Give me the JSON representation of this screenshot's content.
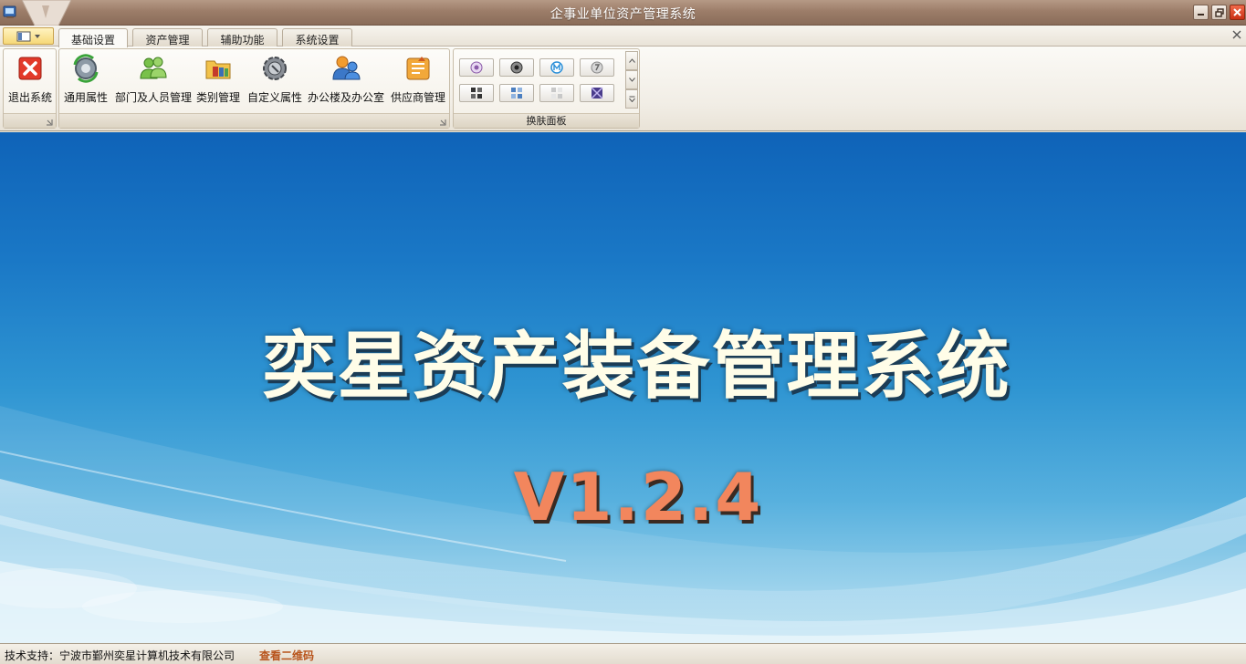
{
  "window": {
    "title": "企事业单位资产管理系统"
  },
  "ribbon": {
    "tabs": [
      {
        "label": "基础设置",
        "active": true
      },
      {
        "label": "资产管理",
        "active": false
      },
      {
        "label": "辅助功能",
        "active": false
      },
      {
        "label": "系统设置",
        "active": false
      }
    ],
    "exit_group": {
      "buttons": [
        {
          "label": "退出系统",
          "icon": "exit-icon"
        }
      ]
    },
    "basic_group": {
      "buttons": [
        {
          "label": "通用属性",
          "icon": "gear-refresh-icon"
        },
        {
          "label": "部门及人员管理",
          "icon": "users-icon"
        },
        {
          "label": "类别管理",
          "icon": "category-folder-icon"
        },
        {
          "label": "自定义属性",
          "icon": "custom-gear-icon"
        },
        {
          "label": "办公楼及办公室",
          "icon": "office-user-icon"
        },
        {
          "label": "供应商管理",
          "icon": "supplier-icon"
        }
      ]
    },
    "skin_group": {
      "label": "换肤面板"
    }
  },
  "main": {
    "title": "奕星资产装备管理系统",
    "version": "V1.2.4"
  },
  "statusbar": {
    "support_text": "技术支持：宁波市鄞州奕星计算机技术有限公司",
    "qr_link": "查看二维码"
  },
  "colors": {
    "title_bar": "#9c7d69",
    "main_bg_top": "#0f63b8",
    "main_title": "#fffde8",
    "version": "#f2865d",
    "qr_link": "#b8541c"
  }
}
